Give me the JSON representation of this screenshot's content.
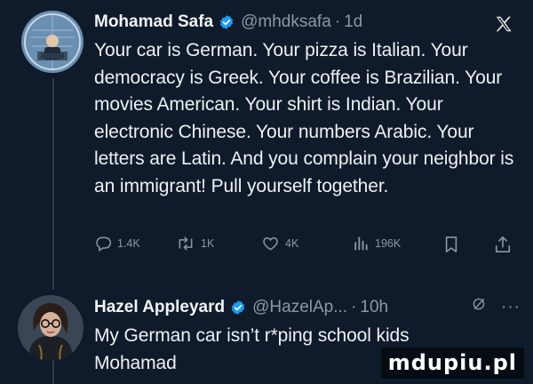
{
  "tweet1": {
    "name": "Mohamad Safa",
    "handle": "@mhdksafa",
    "separator": "·",
    "time": "1d",
    "text": "Your car is German. Your pizza is Italian. Your democracy is Greek. Your coffee is Brazilian. Your movies American. Your shirt is Indian. Your electronic Chinese. Your numbers Arabic. Your letters are Latin. And you complain your neighbor is an immigrant! Pull yourself together.",
    "replies": "1.4K",
    "reposts": "1K",
    "likes": "4K",
    "views": "196K"
  },
  "tweet2": {
    "name": "Hazel Appleyard",
    "handle": "@HazelAp...",
    "separator": "·",
    "time": "10h",
    "more": "···",
    "text": "My German car isn’t r*ping school kids Mohamad"
  },
  "watermark": "mdupiu.pl",
  "colors": {
    "background": "#0f1b2b",
    "verified": "#1d9bf0",
    "muted": "#8b98a5",
    "text": "#e7e9ea"
  },
  "icons": [
    "verified-badge-icon",
    "x-logo-icon",
    "reply-icon",
    "repost-icon",
    "like-icon",
    "views-icon",
    "bookmark-icon",
    "share-icon",
    "grok-icon"
  ]
}
